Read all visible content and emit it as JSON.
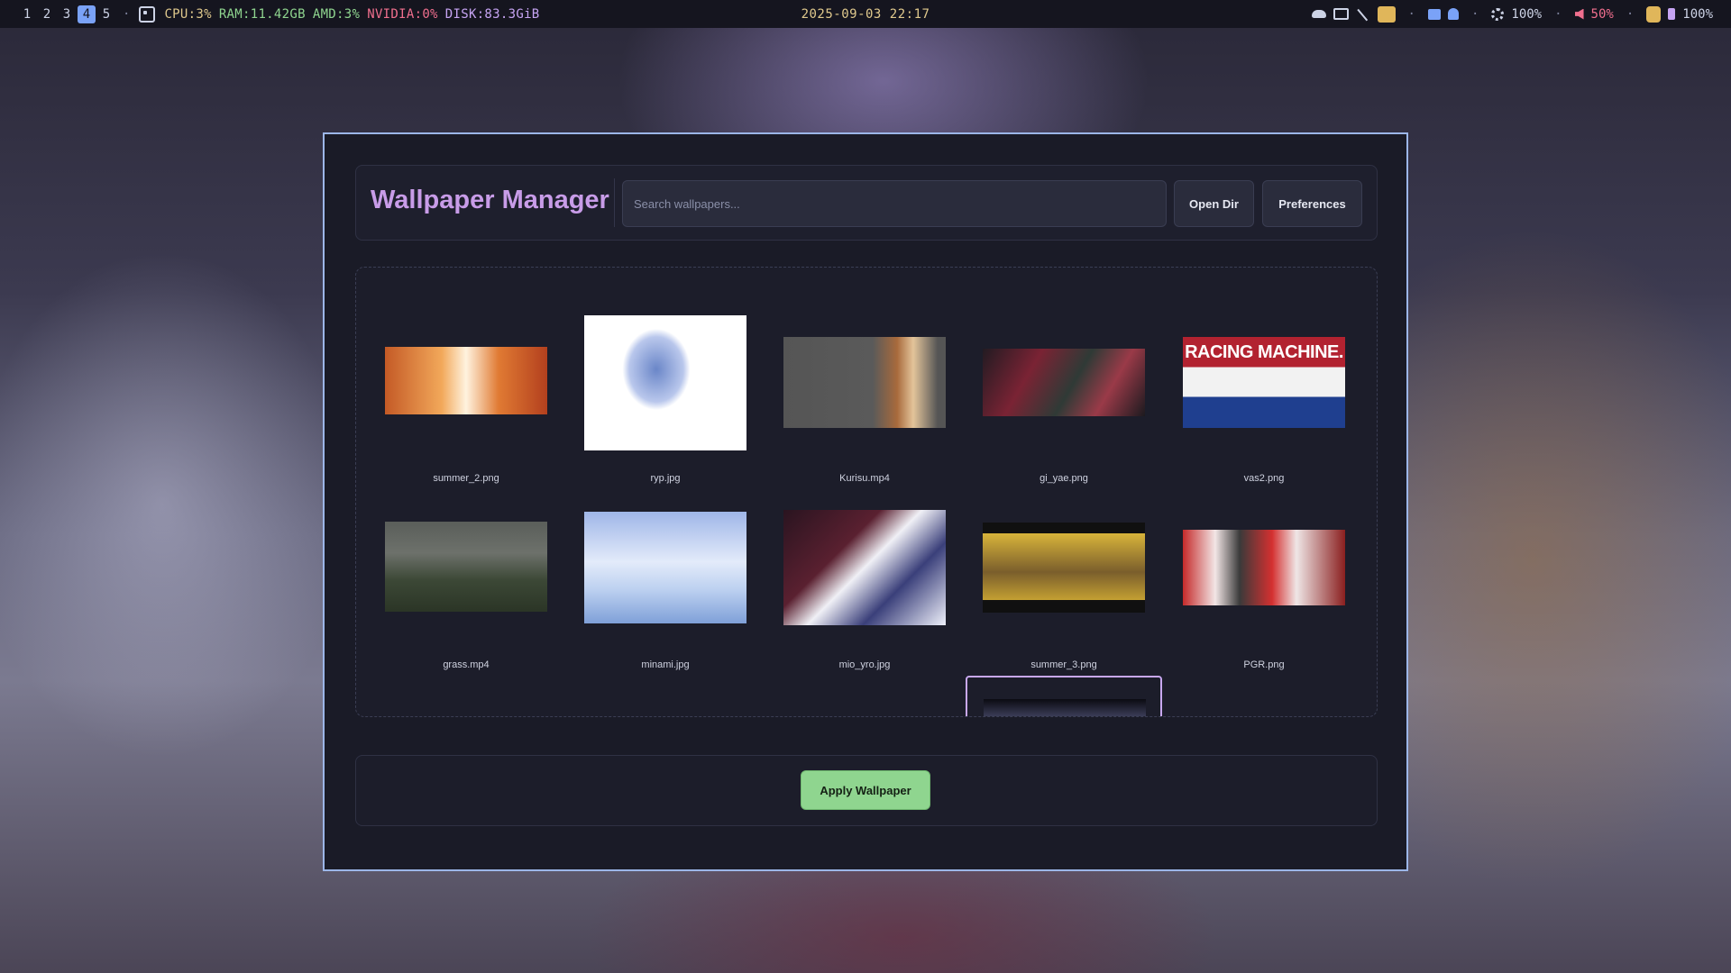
{
  "statusbar": {
    "workspaces": [
      "1",
      "2",
      "3",
      "4",
      "5"
    ],
    "active_workspace": "4",
    "separator": "·",
    "stats": {
      "cpu": "CPU:3%",
      "ram": "RAM:11.42GB",
      "amd": "AMD:3%",
      "nvidia": "NVIDIA:0%",
      "disk": "DISK:83.3GiB"
    },
    "clock": "2025-09-03 22:17",
    "tray": {
      "brightness": "100%",
      "volume": "50%",
      "battery": "100%"
    },
    "colors": {
      "cpu": "#e0c98d",
      "ram": "#8fd58f",
      "amd": "#8fd58f",
      "nvidia": "#f06f8e",
      "disk": "#c6a4f3"
    }
  },
  "window": {
    "title": "Wallpaper Manager",
    "search": {
      "placeholder": "Search wallpapers...",
      "value": ""
    },
    "buttons": {
      "open_dir": "Open Dir",
      "preferences": "Preferences"
    },
    "apply_button": "Apply Wallpaper",
    "accent": "#c89ce8"
  },
  "wallpapers": [
    {
      "name": "summer_2.png",
      "icon": "thumbnail-image"
    },
    {
      "name": "ryp.jpg",
      "icon": "thumbnail-image"
    },
    {
      "name": "Kurisu.mp4",
      "icon": "thumbnail-video"
    },
    {
      "name": "gi_yae.png",
      "icon": "thumbnail-image"
    },
    {
      "name": "vas2.png",
      "icon": "thumbnail-image",
      "caption": "RACING MACHINE."
    },
    {
      "name": "grass.mp4",
      "icon": "thumbnail-video"
    },
    {
      "name": "minami.jpg",
      "icon": "thumbnail-image"
    },
    {
      "name": "mio_yro.jpg",
      "icon": "thumbnail-image"
    },
    {
      "name": "summer_3.png",
      "icon": "thumbnail-image"
    },
    {
      "name": "PGR.png",
      "icon": "thumbnail-image"
    }
  ]
}
